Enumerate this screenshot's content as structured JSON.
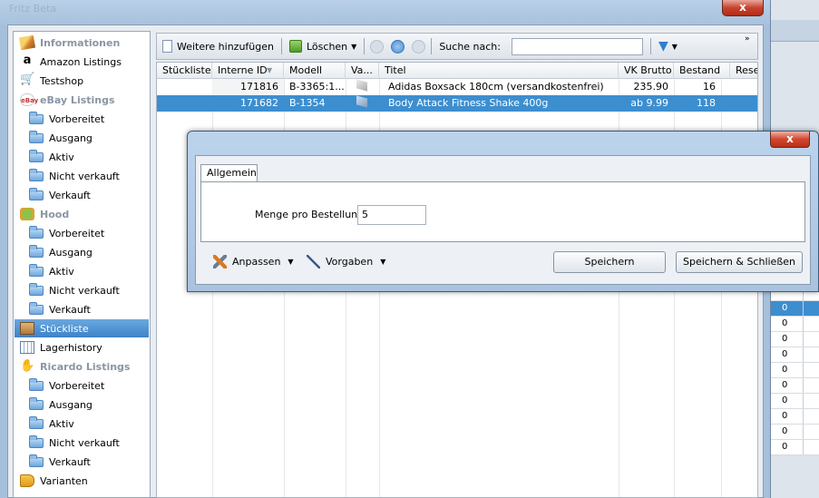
{
  "background_window": {
    "title": "Fritz Beta",
    "close_label": "x"
  },
  "sidebar": {
    "items": [
      {
        "label": "Informationen",
        "type": "header",
        "icon": "pencil-icon"
      },
      {
        "label": "Amazon Listings",
        "type": "item",
        "icon": "amazon-icon"
      },
      {
        "label": "Testshop",
        "type": "item",
        "icon": "cart-icon"
      },
      {
        "label": "eBay Listings",
        "type": "header",
        "icon": "ebay-icon"
      },
      {
        "label": "Vorbereitet",
        "type": "sub",
        "icon": "folder-icon"
      },
      {
        "label": "Ausgang",
        "type": "sub",
        "icon": "folder-icon"
      },
      {
        "label": "Aktiv",
        "type": "sub",
        "icon": "folder-icon"
      },
      {
        "label": "Nicht verkauft",
        "type": "sub",
        "icon": "folder-icon"
      },
      {
        "label": "Verkauft",
        "type": "sub",
        "icon": "folder-icon"
      },
      {
        "label": "Hood",
        "type": "header",
        "icon": "hood-icon"
      },
      {
        "label": "Vorbereitet",
        "type": "sub",
        "icon": "folder-icon"
      },
      {
        "label": "Ausgang",
        "type": "sub",
        "icon": "folder-icon"
      },
      {
        "label": "Aktiv",
        "type": "sub",
        "icon": "folder-icon"
      },
      {
        "label": "Nicht verkauft",
        "type": "sub",
        "icon": "folder-icon"
      },
      {
        "label": "Verkauft",
        "type": "sub",
        "icon": "folder-icon"
      },
      {
        "label": "Stückliste",
        "type": "item",
        "icon": "box-icon",
        "selected": true
      },
      {
        "label": "Lagerhistory",
        "type": "item",
        "icon": "table-icon"
      },
      {
        "label": "Ricardo Listings",
        "type": "header",
        "icon": "hand-icon"
      },
      {
        "label": "Vorbereitet",
        "type": "sub",
        "icon": "folder-icon"
      },
      {
        "label": "Ausgang",
        "type": "sub",
        "icon": "folder-icon"
      },
      {
        "label": "Aktiv",
        "type": "sub",
        "icon": "folder-icon"
      },
      {
        "label": "Nicht verkauft",
        "type": "sub",
        "icon": "folder-icon"
      },
      {
        "label": "Verkauft",
        "type": "sub",
        "icon": "folder-icon"
      },
      {
        "label": "Varianten",
        "type": "item",
        "icon": "tag-icon"
      }
    ]
  },
  "toolbar": {
    "add_label": "Weitere hinzufügen",
    "delete_label": "Löschen",
    "search_label": "Suche nach:",
    "search_value": ""
  },
  "grid": {
    "columns": [
      "Stückliste",
      "Interne ID",
      "Modell",
      "Va...",
      "Titel",
      "VK Brutto",
      "Bestand",
      "Rese"
    ],
    "rows": [
      {
        "stueckliste": "",
        "interne_id": "171816",
        "modell": "B-3365:1...",
        "titel": "Adidas Boxsack 180cm (versandkostenfrei)",
        "vk_brutto": "235.90",
        "bestand": "16",
        "selected": false
      },
      {
        "stueckliste": "",
        "interne_id": "171682",
        "modell": "B-1354",
        "titel": "Body Attack Fitness Shake 400g",
        "vk_brutto": "ab 9.99",
        "bestand": "118",
        "selected": true
      }
    ]
  },
  "right_column_values": [
    "0",
    "0",
    "0",
    "0",
    "0",
    "0",
    "0",
    "0",
    "0",
    "0"
  ],
  "dialog": {
    "close_label": "x",
    "tab_label": "Allgemein",
    "field_label": "Menge pro Bestellung",
    "field_value": "5",
    "customize_label": "Anpassen",
    "defaults_label": "Vorgaben",
    "save_label": "Speichern",
    "save_close_label": "Speichern & Schließen"
  },
  "colors": {
    "selection": "#3d8ecf",
    "close_button": "#c7432e"
  }
}
